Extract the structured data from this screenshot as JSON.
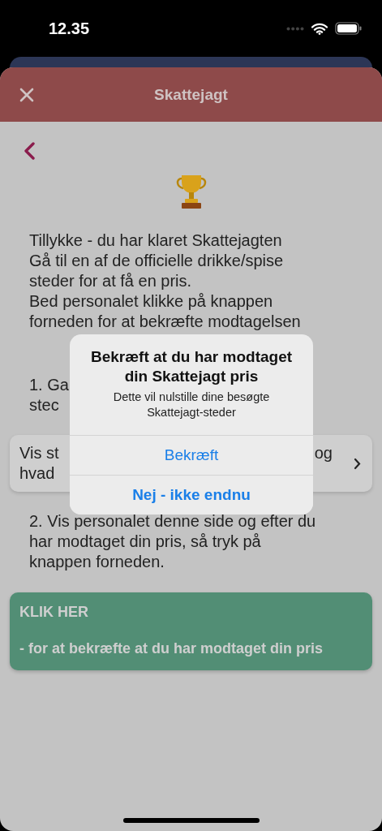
{
  "status_bar": {
    "time": "12.35"
  },
  "header": {
    "title": "Skattejagt"
  },
  "intro": "Tillykke - du har klaret Skattejagten\nGå til en af de officielle drikke/spise\nsteder for at få en pris.\nBed personalet klikke på knappen\nforneden for at bekræfte modtagelsen",
  "step_1": {
    "visible_lines": [
      "1. Ga",
      "stec"
    ]
  },
  "places_card": {
    "visible_lines": [
      "Vis st",
      "hvad"
    ],
    "right_text": "og"
  },
  "step_2": "2. Vis personalet denne side og efter du\nhar modtaget din pris, så tryk på\nknappen forneden.",
  "confirm_button": {
    "heading": "KLIK HER",
    "text": "- for at bekræfte at du har modtaget din pris"
  },
  "dialog": {
    "title": "Bekræft at du har modtaget din Skattejagt pris",
    "message": "Dette vil nulstille dine besøgte Skattejagt-steder",
    "actions": [
      {
        "label": "Bekræft",
        "kind": "default"
      },
      {
        "label": "Nej - ikke endnu",
        "kind": "preferred"
      }
    ]
  }
}
